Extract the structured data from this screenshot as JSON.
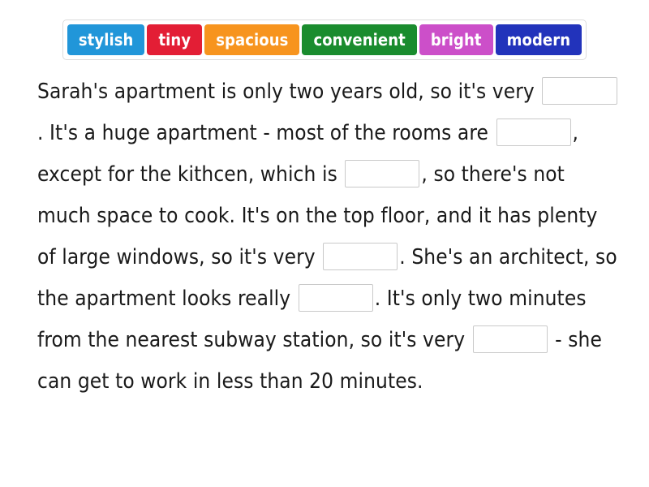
{
  "wordbank": {
    "tiles": [
      {
        "label": "stylish",
        "color": "#2196d9"
      },
      {
        "label": "tiny",
        "color": "#e31e35"
      },
      {
        "label": "spacious",
        "color": "#f7941e"
      },
      {
        "label": "convenient",
        "color": "#1a8c2e"
      },
      {
        "label": "bright",
        "color": "#cc4fc9"
      },
      {
        "label": "modern",
        "color": "#2233bb"
      }
    ]
  },
  "passage": {
    "segments": [
      {
        "type": "text",
        "value": "Sarah's apartment is only two years old, so it's very "
      },
      {
        "type": "blank",
        "value": ""
      },
      {
        "type": "text",
        "value": ". It's a huge apartment - most of the rooms are "
      },
      {
        "type": "blank",
        "value": ""
      },
      {
        "type": "text",
        "value": ", except for the kithcen, which is "
      },
      {
        "type": "blank",
        "value": ""
      },
      {
        "type": "text",
        "value": ", so there's not much space to cook. It's on the top floor, and it has plenty of large windows, so it's very "
      },
      {
        "type": "blank",
        "value": ""
      },
      {
        "type": "text",
        "value": ". She's an architect, so the apartment looks really "
      },
      {
        "type": "blank",
        "value": ""
      },
      {
        "type": "text",
        "value": ". It's only two minutes from the nearest subway station, so it's very "
      },
      {
        "type": "blank",
        "value": ""
      },
      {
        "type": "text",
        "value": " - she can get to work in less than 20 minutes."
      }
    ],
    "full_text": "Sarah's apartment is only two years old, so it's very ___. It's a huge apartment - most of the rooms are ___, except for the kithcen, which is ___, so there's not much space to cook. It's on the top floor, and it has plenty of large windows, so it's very ___. She's an architect, so the apartment looks really ___. It's only two minutes from the nearest subway station, so it's very ___ - she can get to work in less than 20 minutes."
  }
}
